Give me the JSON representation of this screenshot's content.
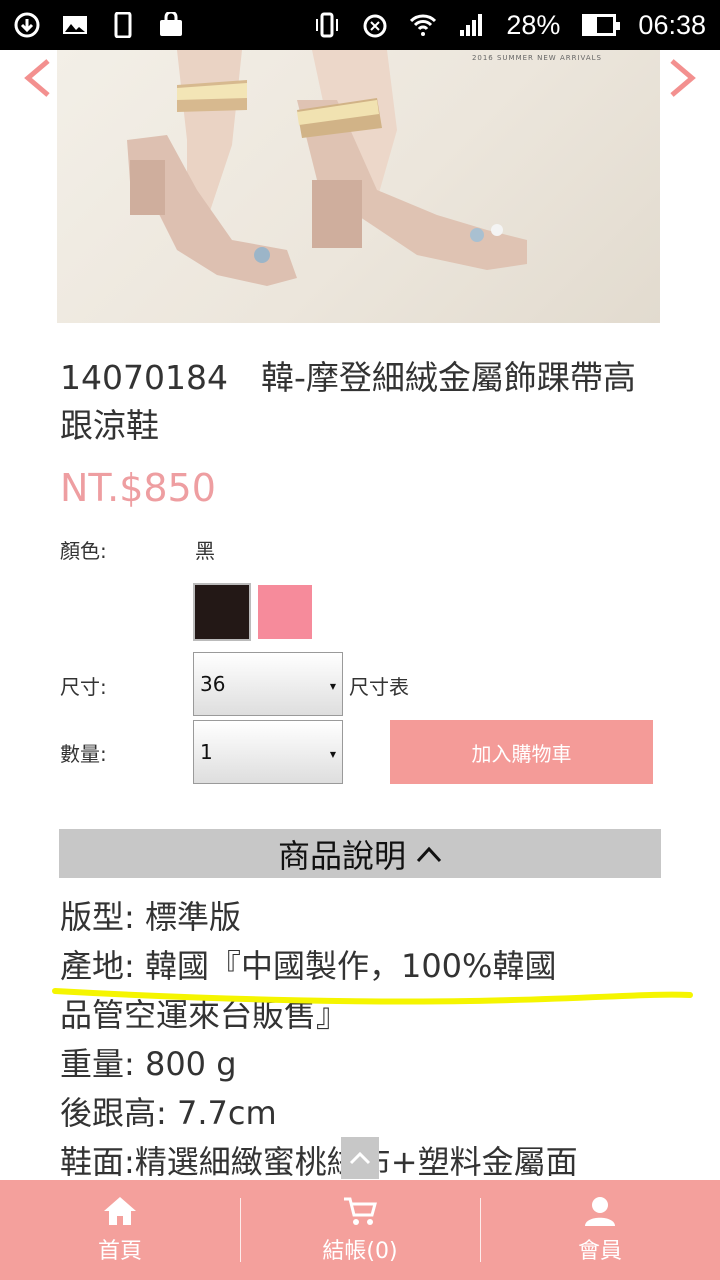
{
  "status_bar": {
    "battery": "28%",
    "time": "06:38",
    "icons": [
      "download-icon",
      "image-icon",
      "phone-icon",
      "shopping-bag-icon",
      "vibrate-icon",
      "alarm-icon",
      "wifi-icon",
      "signal-icon",
      "battery-icon"
    ]
  },
  "hero": {
    "caption": "2016 SUMMER  NEW ARRIVALS",
    "prev_icon": "chevron-left-icon",
    "next_icon": "chevron-right-icon"
  },
  "product": {
    "title": "14070184　韓-摩登細絨金屬飾踝帶高跟涼鞋",
    "price": "NT.$850",
    "color_label": "顏色:",
    "color_value": "黑",
    "swatches": [
      "#231816",
      "#f68b9b"
    ],
    "size_label": "尺寸:",
    "size_value": "36",
    "size_table": "尺寸表",
    "qty_label": "數量:",
    "qty_value": "1",
    "add_to_cart": "加入購物車"
  },
  "description": {
    "header": "商品說明",
    "lines": [
      "版型: 標準版",
      "產地: 韓國『中國製作，100%韓國",
      "品管空運來台販售』",
      "重量: 800 g",
      "後跟高:  7.7cm",
      "鞋面:精選細緻蜜桃絨布+塑料金屬面"
    ]
  },
  "bottom_nav": {
    "items": [
      {
        "label": "首頁",
        "icon": "home-icon"
      },
      {
        "label": "結帳(0)",
        "icon": "cart-icon"
      },
      {
        "label": "會員",
        "icon": "user-icon"
      }
    ]
  },
  "colors": {
    "accent": "#f49b98",
    "price": "#ee9ea1",
    "highlight": "#f5f500"
  }
}
